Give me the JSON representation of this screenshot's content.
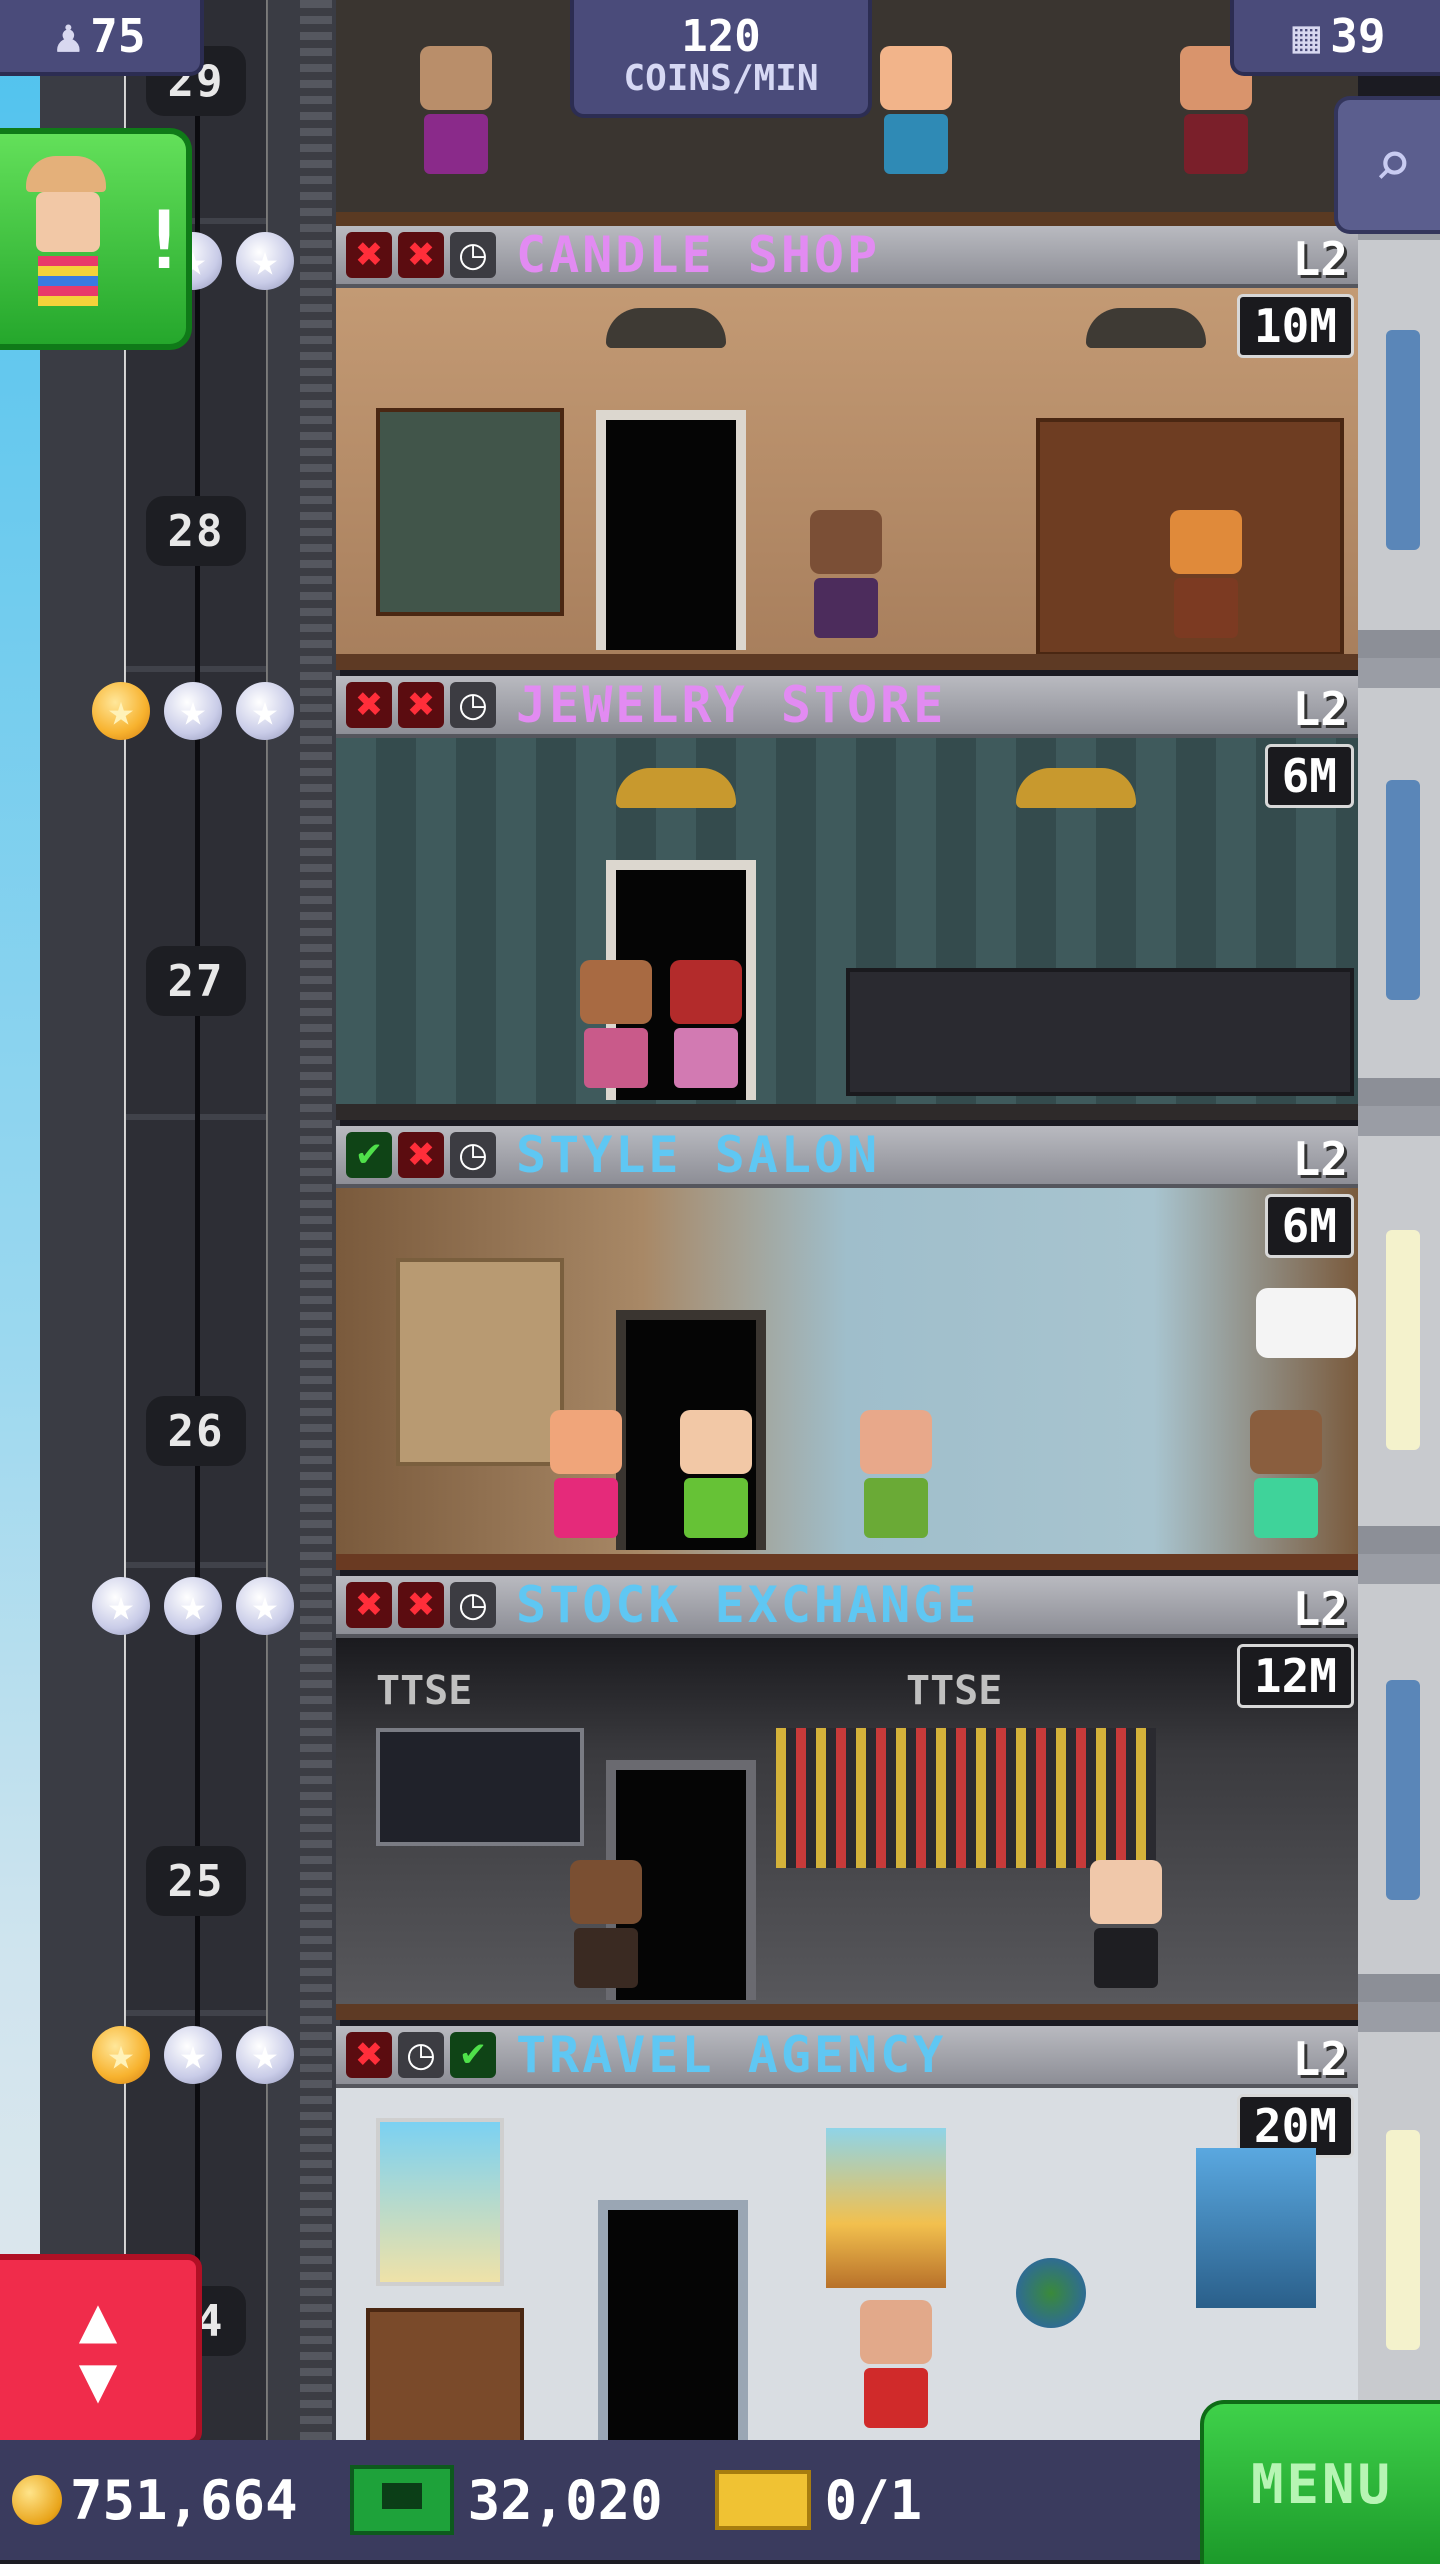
{
  "top_bar": {
    "population": "75",
    "coins_rate_value": "120",
    "coins_rate_unit": "COINS/MIN",
    "floors_count": "39"
  },
  "shaft_floor_numbers": [
    "29",
    "28",
    "27",
    "26",
    "25",
    "24"
  ],
  "floors": [
    {
      "name": "CANDLE SHOP",
      "level": "L2",
      "stock_time": "10M",
      "name_color": "#e28bf2",
      "status_icons": [
        "x",
        "x",
        "clock"
      ]
    },
    {
      "name": "JEWELRY STORE",
      "level": "L2",
      "stock_time": "6M",
      "name_color": "#e28bf2",
      "status_icons": [
        "x",
        "x",
        "clock"
      ]
    },
    {
      "name": "STYLE SALON",
      "level": "L2",
      "stock_time": "6M",
      "name_color": "#5fc7f3",
      "status_icons": [
        "check",
        "x",
        "clock"
      ]
    },
    {
      "name": "STOCK EXCHANGE",
      "level": "L2",
      "stock_time": "12M",
      "name_color": "#5fc7f3",
      "status_icons": [
        "x",
        "x",
        "clock"
      ]
    },
    {
      "name": "TRAVEL AGENCY",
      "level": "L2",
      "stock_time": "20M",
      "name_color": "#5fc7f3",
      "status_icons": [
        "x",
        "clock",
        "check"
      ]
    }
  ],
  "star_rows": [
    {
      "gold": 0,
      "total": 3
    },
    {
      "gold": 1,
      "total": 3
    },
    {
      "gold": 0,
      "total": 3
    },
    {
      "gold": 1,
      "total": 3
    }
  ],
  "room_signs": {
    "stock_exchange_board_1": "TTSE",
    "stock_exchange_board_2": "TTSE"
  },
  "bottom_bar": {
    "coins": "751,664",
    "tower_bux": "32,020",
    "tickets": "0/1",
    "menu_label": "MENU"
  },
  "icons": {
    "population": "person-icon",
    "floors": "building-icon",
    "search": "magnifier-icon",
    "visitor": "visitor-alert-icon",
    "elevator": "elevator-up-down-icon"
  },
  "colors": {
    "accent_green": "#2fbf3a",
    "elevator_red": "#f02c4b",
    "bar_blue": "#3a3b5e"
  }
}
